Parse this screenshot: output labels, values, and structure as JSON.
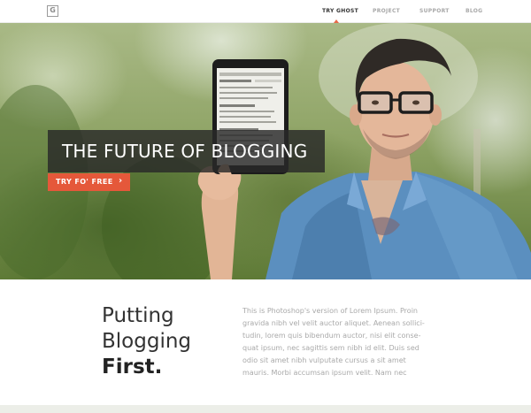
{
  "nav": {
    "logo_letter": "G",
    "items": [
      {
        "label": "TRY GHOST",
        "active": true
      },
      {
        "label": "PROJECT",
        "active": false
      },
      {
        "label": "SUPPORT",
        "active": false
      },
      {
        "label": "BLOG",
        "active": false
      }
    ],
    "accent_color": "#e86a49"
  },
  "hero": {
    "tagline": "THE FUTURE OF BLOGGING",
    "cta_label": "TRY FO' FREE",
    "cta_arrow": "›",
    "cta_color": "#e5583a"
  },
  "content": {
    "heading_lines": [
      "Putting",
      "Blogging",
      "First."
    ],
    "body_lines": [
      "This is Photoshop's version  of Lorem Ipsum. Proin",
      "gravida nibh vel velit auctor aliquet. Aenean sollici-",
      "tudin, lorem quis bibendum auctor, nisi elit conse-",
      "quat ipsum, nec sagittis sem nibh id elit. Duis sed",
      "odio sit amet nibh vulputate cursus a sit amet",
      "mauris. Morbi accumsan ipsum velit. Nam nec"
    ]
  }
}
